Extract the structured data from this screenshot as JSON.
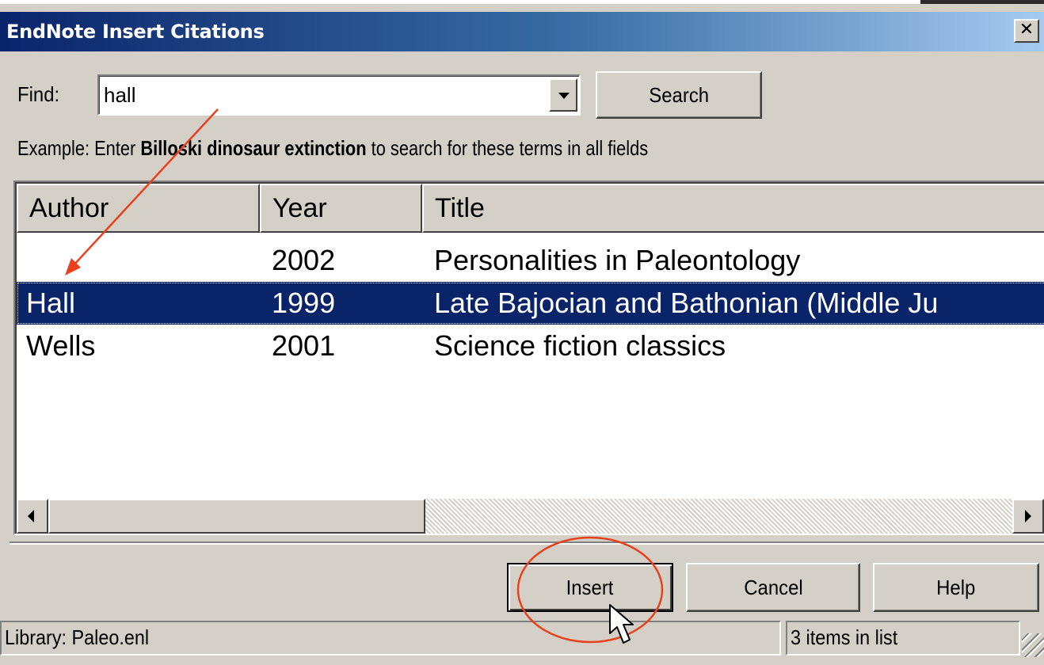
{
  "window": {
    "title": "EndNote Insert Citations",
    "close_label": "✕"
  },
  "search": {
    "find_label": "Find:",
    "find_value": "hall",
    "search_button": "Search",
    "example_prefix": "Example: Enter ",
    "example_terms": "Billoski dinosaur extinction",
    "example_suffix": " to search for these terms in all fields"
  },
  "list": {
    "columns": [
      "Author",
      "Year",
      "Title"
    ],
    "rows": [
      {
        "author": "",
        "year": "2002",
        "title": "Personalities in Paleontology",
        "selected": false
      },
      {
        "author": "Hall",
        "year": "1999",
        "title": "Late Bajocian and Bathonian (Middle Ju",
        "selected": true
      },
      {
        "author": "Wells",
        "year": "2001",
        "title": "Science fiction classics",
        "selected": false
      }
    ]
  },
  "buttons": {
    "insert": "Insert",
    "cancel": "Cancel",
    "help": "Help"
  },
  "status": {
    "library": "Library: Paleo.enl",
    "count": "3 items in list"
  },
  "colors": {
    "selection": "#0a246a",
    "annotation": "#e8411e",
    "face": "#d4d0c8"
  }
}
